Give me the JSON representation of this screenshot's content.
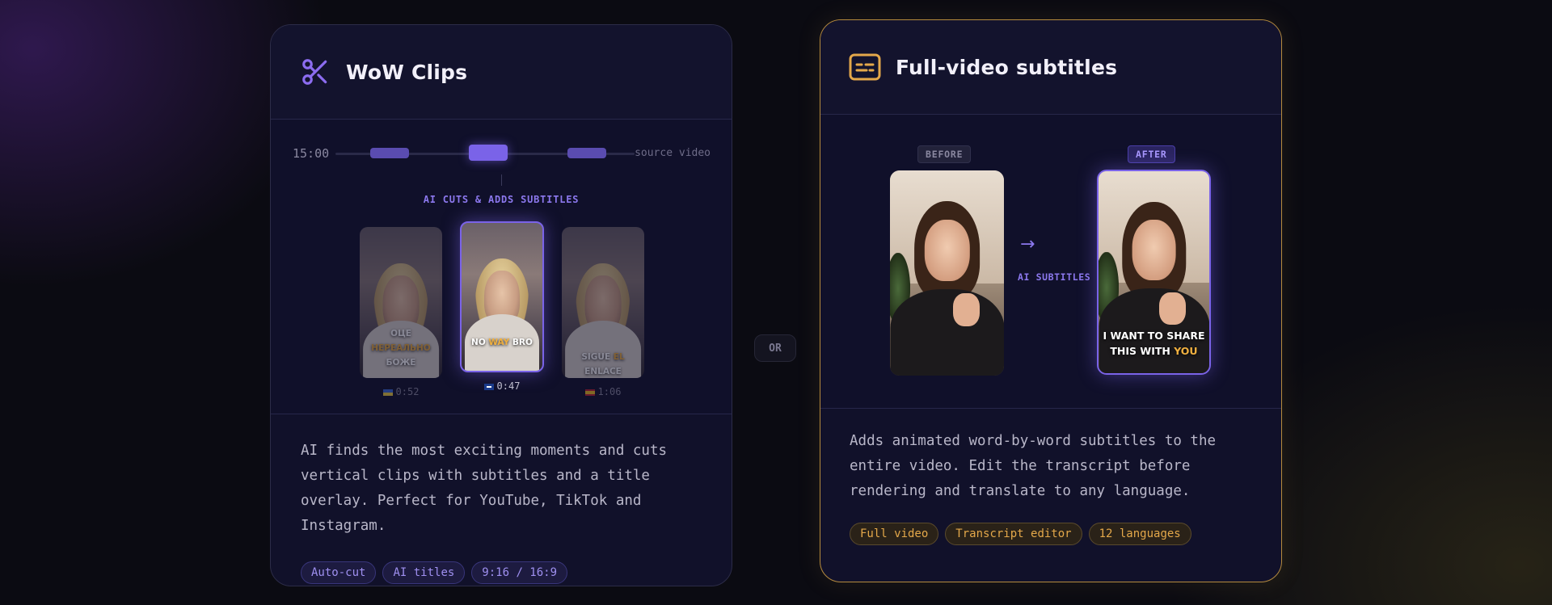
{
  "or_label": "OR",
  "left_card": {
    "title": "WoW Clips",
    "icon": "scissors-icon",
    "timeline": {
      "duration": "15:00",
      "source_label": "source video"
    },
    "ai_cuts_label": "AI CUTS & ADDS SUBTITLES",
    "clips": [
      {
        "caption_lines": [
          "ОЦЕ",
          "НЕРЕАЛЬНО",
          "БОЖЕ"
        ],
        "highlight_word": "НЕРЕАЛЬНО",
        "flag": "ukraine-flag",
        "duration": "0:52"
      },
      {
        "caption_pre": "NO ",
        "caption_hl": "WAY",
        "caption_post": " BRO",
        "flag": "uk-flag",
        "duration": "0:47"
      },
      {
        "caption_pre": "SIGUE ",
        "caption_hl": "EL",
        "caption_post": " ENLACE",
        "flag": "spain-flag",
        "duration": "1:06"
      }
    ],
    "description": "AI finds the most exciting moments and cuts vertical clips with subtitles and a title overlay. Perfect for YouTube, TikTok and Instagram.",
    "tags": [
      "Auto-cut",
      "AI titles",
      "9:16 / 16:9"
    ]
  },
  "right_card": {
    "title": "Full-video subtitles",
    "icon": "subtitles-icon",
    "before_label": "BEFORE",
    "after_label": "AFTER",
    "arrow_label": "AI SUBTITLES",
    "after_caption_line1": "I WANT TO SHARE",
    "after_caption_pre": "THIS WITH ",
    "after_caption_hl": "YOU",
    "description": "Adds animated word-by-word subtitles to the entire video. Edit the transcript before rendering and translate to any language.",
    "tags": [
      "Full video",
      "Transcript editor",
      "12 languages"
    ]
  },
  "colors": {
    "accent_purple": "#7a63e8",
    "accent_gold": "#b58a3e",
    "highlight": "#f0b040"
  }
}
